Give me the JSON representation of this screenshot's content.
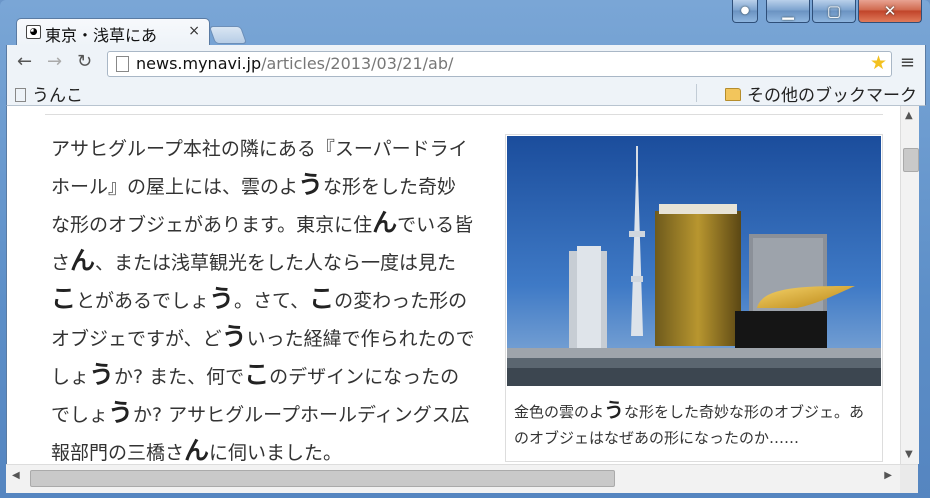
{
  "tab": {
    "title": "東京・浅草にあ",
    "close": "×"
  },
  "toolbar": {
    "back": "←",
    "forward": "→",
    "reload": "↻",
    "url_host": "news.mynavi.jp",
    "url_path": "/articles/2013/03/21/ab/",
    "star": "★",
    "menu": "≡"
  },
  "bookmarks": {
    "item": "うんこ",
    "other": "その他のブックマーク"
  },
  "article": {
    "segments": [
      {
        "t": "アサヒグループ本社の隣にある『スーパードライホール』の屋上には、雲のよ"
      },
      {
        "b": "う"
      },
      {
        "t": "な形をした奇妙な形のオブジェがあります。東京に住"
      },
      {
        "b": "ん"
      },
      {
        "t": "でいる皆さ"
      },
      {
        "b": "ん"
      },
      {
        "t": "、または浅草観光をした人なら一度は見た"
      },
      {
        "b": "こ"
      },
      {
        "t": "とがあるでしょ"
      },
      {
        "b": "う"
      },
      {
        "t": "。さて、"
      },
      {
        "b": "こ"
      },
      {
        "t": "の変わった形のオブジェですが、ど"
      },
      {
        "b": "う"
      },
      {
        "t": "いった経緯で作られたのでしょ"
      },
      {
        "b": "う"
      },
      {
        "t": "か? また、何で"
      },
      {
        "b": "こ"
      },
      {
        "t": "のデザインになったのでしょ"
      },
      {
        "b": "う"
      },
      {
        "t": "か? アサヒグループホールディングス広報部門の三橋さ"
      },
      {
        "b": "ん"
      },
      {
        "t": "に伺いました。"
      }
    ]
  },
  "caption": {
    "part1": "金色の雲のよ",
    "big": "う",
    "part2": "な形をした奇妙な形のオブジェ。あのオブジェはなぜあの形になったのか……"
  },
  "colors": {
    "frame": "#6b96c9",
    "close_button": "#c1442a",
    "star": "#f3c11f"
  }
}
